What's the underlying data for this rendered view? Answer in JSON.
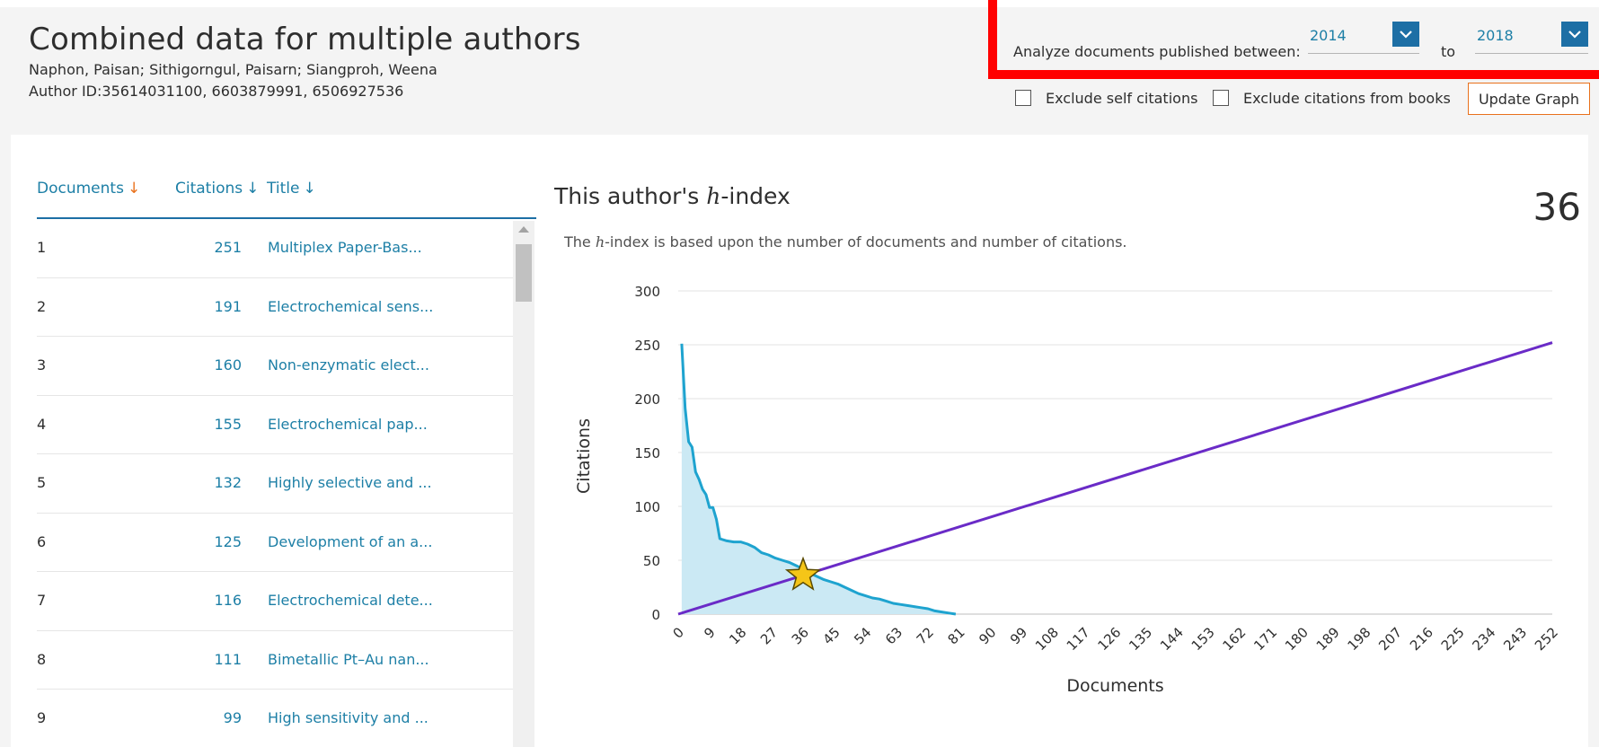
{
  "header": {
    "title": "Combined data for multiple authors",
    "authors": "Naphon, Paisan; Sithigorngul, Paisarn; Siangproh, Weena",
    "author_id": "Author ID:35614031100, 6603879991, 6506927536"
  },
  "filters": {
    "analyze_label": "Analyze documents published between:",
    "from_year": "2014",
    "to_label": "to",
    "to_year": "2018",
    "exclude_self_label": "Exclude self citations",
    "exclude_self_checked": false,
    "exclude_books_label": "Exclude citations from books",
    "exclude_books_checked": false,
    "update_button": "Update Graph"
  },
  "table": {
    "headers": {
      "documents": "Documents",
      "citations": "Citations",
      "title": "Title"
    },
    "rows": [
      {
        "num": "1",
        "citations": "251",
        "title": "Multiplex Paper-Bas..."
      },
      {
        "num": "2",
        "citations": "191",
        "title": "Electrochemical sens..."
      },
      {
        "num": "3",
        "citations": "160",
        "title": "Non-enzymatic elect..."
      },
      {
        "num": "4",
        "citations": "155",
        "title": "Electrochemical pap..."
      },
      {
        "num": "5",
        "citations": "132",
        "title": "Highly selective and ..."
      },
      {
        "num": "6",
        "citations": "125",
        "title": "Development of an a..."
      },
      {
        "num": "7",
        "citations": "116",
        "title": "Electrochemical dete..."
      },
      {
        "num": "8",
        "citations": "111",
        "title": "Bimetallic Pt–Au nan..."
      },
      {
        "num": "9",
        "citations": "99",
        "title": "High sensitivity and ..."
      }
    ]
  },
  "hindex": {
    "title_prefix": "This author's ",
    "title_h": "h",
    "title_suffix": "-index",
    "value": "36",
    "desc_prefix": "The ",
    "desc_h": "h",
    "desc_suffix": "-index is based upon the number of documents and number of citations."
  },
  "colors": {
    "accent": "#1d7fa6",
    "orange": "#e9711c",
    "red_box": "#ff0000",
    "area_fill": "#cbe9f4",
    "curve": "#1ea3cf",
    "diagonal": "#6a2bc7",
    "star": "#f5c518"
  },
  "chart_data": {
    "type": "area",
    "xlabel": "Documents",
    "ylabel": "Citations",
    "ylim": [
      0,
      300
    ],
    "xlim": [
      0,
      252
    ],
    "yticks": [
      0,
      50,
      100,
      150,
      200,
      250,
      300
    ],
    "xticks": [
      0,
      9,
      18,
      27,
      36,
      45,
      54,
      63,
      72,
      81,
      90,
      99,
      108,
      117,
      126,
      135,
      144,
      153,
      162,
      171,
      180,
      189,
      198,
      207,
      216,
      225,
      234,
      243,
      252
    ],
    "grid": true,
    "series": [
      {
        "x": [
          1,
          2,
          3,
          4,
          5,
          6,
          7,
          8,
          9,
          10,
          11,
          12,
          14,
          16,
          18,
          20,
          22,
          24,
          26,
          28,
          30,
          32,
          34,
          36,
          38,
          40,
          42,
          44,
          46,
          48,
          50,
          52,
          54,
          56,
          58,
          60,
          62,
          64,
          66,
          68,
          70,
          72,
          74,
          76,
          78,
          80
        ],
        "values": [
          251,
          191,
          160,
          155,
          132,
          125,
          116,
          111,
          99,
          99,
          88,
          70,
          68,
          67,
          67,
          65,
          62,
          57,
          55,
          52,
          50,
          48,
          45,
          42,
          38,
          35,
          32,
          30,
          28,
          25,
          22,
          19,
          17,
          15,
          14,
          12,
          10,
          9,
          8,
          7,
          6,
          5,
          3,
          2,
          1,
          0
        ]
      },
      {
        "x": [
          0,
          252
        ],
        "values": [
          0,
          252
        ]
      }
    ],
    "marker": {
      "x": 36,
      "y": 36,
      "shape": "star"
    }
  }
}
